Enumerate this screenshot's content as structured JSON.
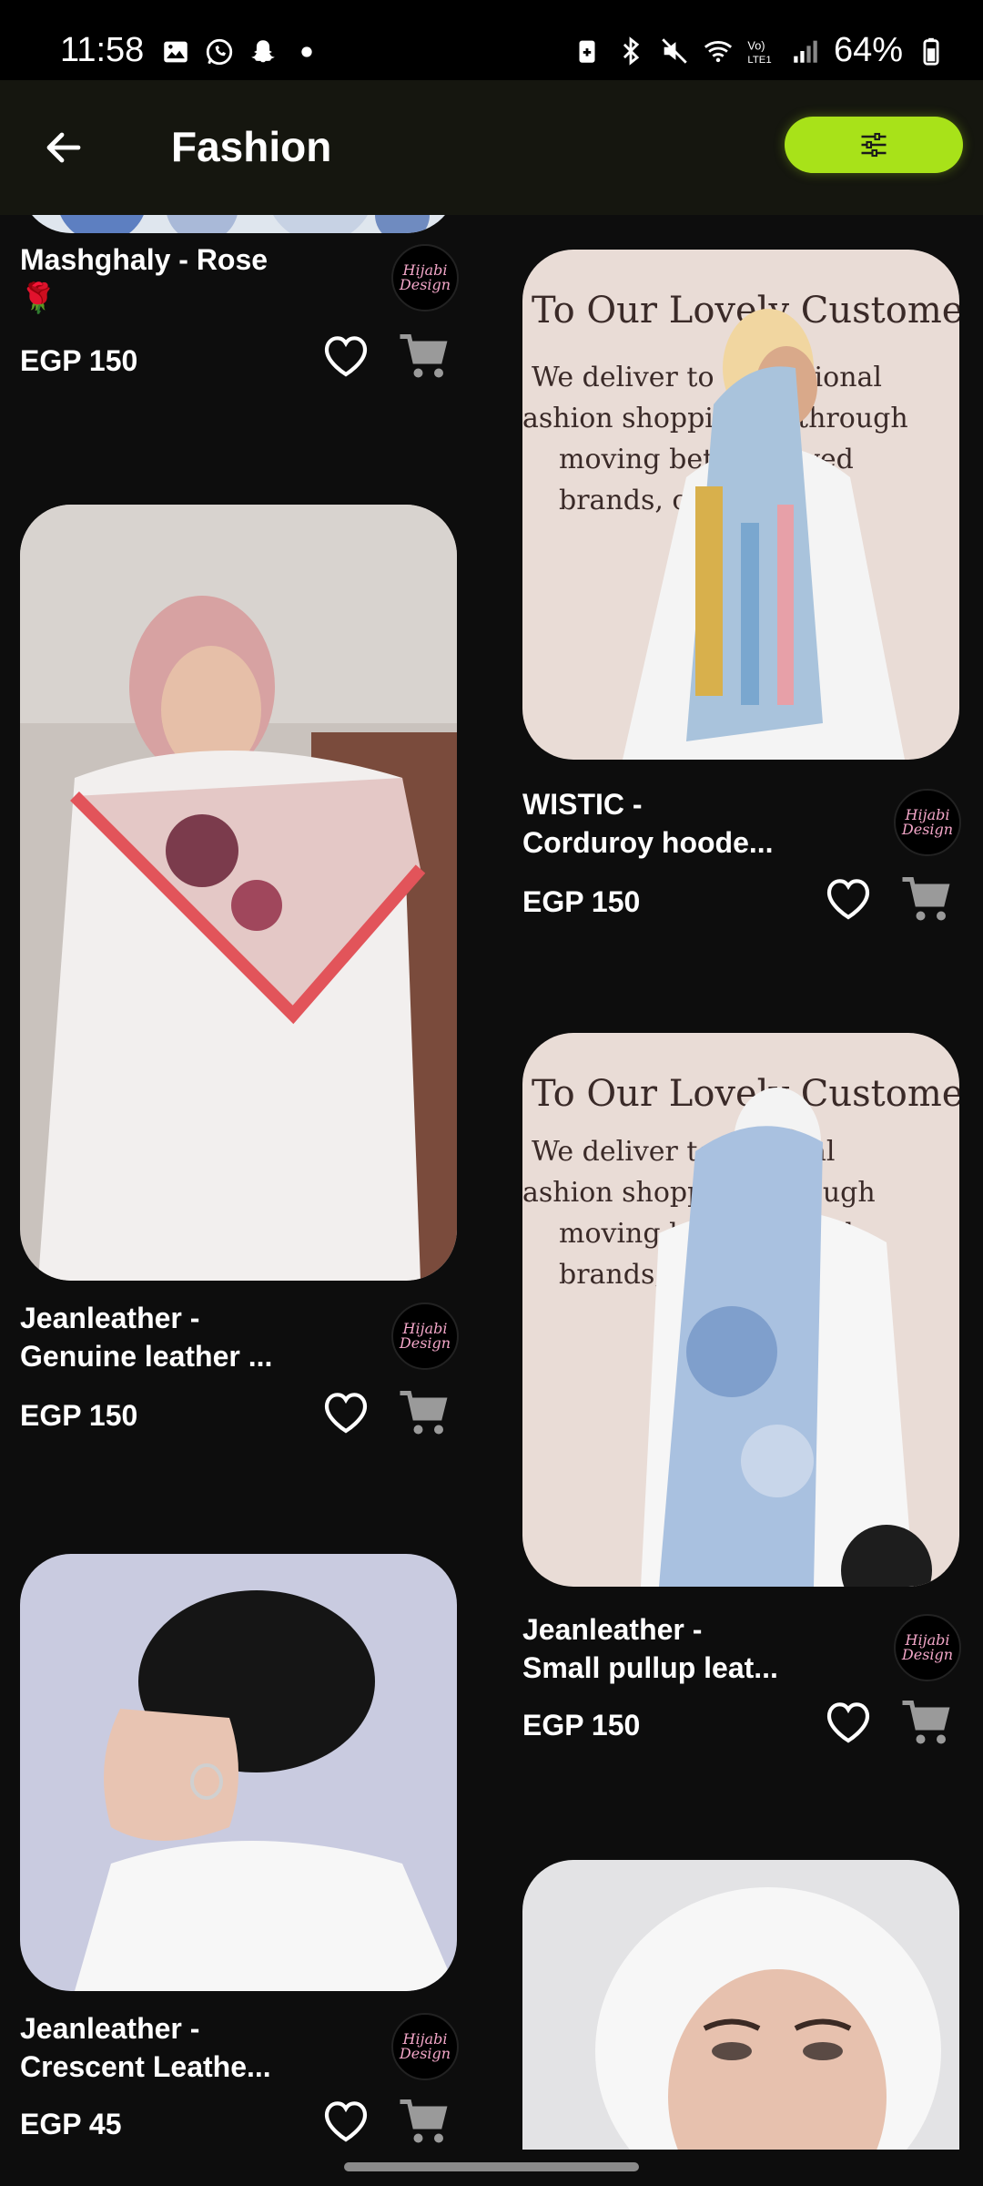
{
  "status_bar": {
    "time": "11:58",
    "battery_percent": "64%",
    "left_icons": [
      "gallery-icon",
      "whatsapp-icon",
      "snapchat-icon",
      "dot-icon"
    ],
    "right_icons": [
      "battery-saver-icon",
      "bluetooth-icon",
      "mute-icon",
      "wifi-icon",
      "volte-icon",
      "signal-icon",
      "battery-icon"
    ]
  },
  "app_bar": {
    "title": "Fashion",
    "back_icon": "arrow-left-icon",
    "filter_icon": "sliders-icon",
    "accent_color": "#a8e219"
  },
  "products": [
    {
      "name": "Mashghaly - Rose\n🌹",
      "price": "EGP 150",
      "seller_logo": "Hijabi Design",
      "image": "scarf-floral-partial"
    },
    {
      "name": "WISTIC -\nCorduroy hoode...",
      "price": "EGP 150",
      "seller_logo": "Hijabi Design",
      "image": "model-pastel-stripe-scarf"
    },
    {
      "name": "Jeanleather  -\nGenuine leather ...",
      "price": "EGP 150",
      "seller_logo": "Hijabi Design",
      "image": "model-red-floral-scarf"
    },
    {
      "name": "Jeanleather  -\nSmall pullup leat...",
      "price": "EGP 150",
      "seller_logo": "Hijabi Design",
      "image": "model-blue-floral-scarf"
    },
    {
      "name": "Jeanleather  -\nCrescent Leathe...",
      "price": "EGP 45",
      "seller_logo": "Hijabi Design",
      "image": "model-black-undercap"
    },
    {
      "name": "",
      "price": "",
      "seller_logo": "",
      "image": "model-white-undercap"
    }
  ],
  "logo_text": "Hijabi\nDesign"
}
